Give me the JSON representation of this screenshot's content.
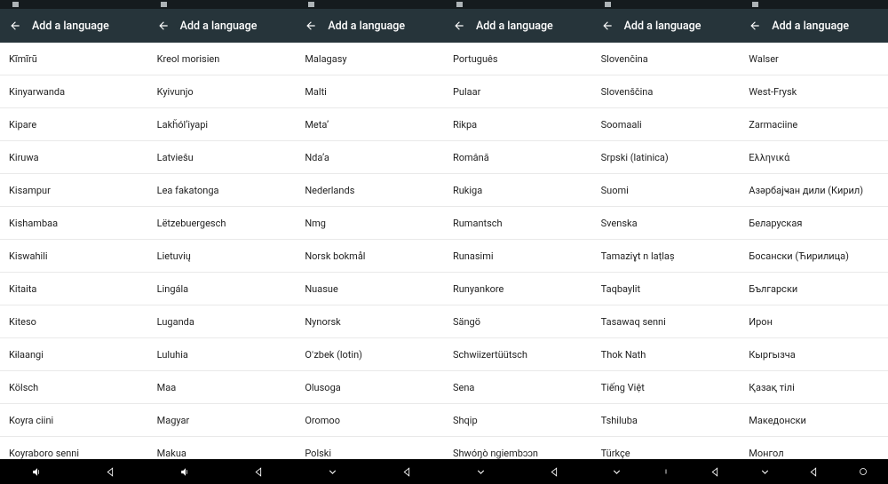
{
  "appbar_title": "Add a language",
  "columns": [
    [
      "Kĩmĩrũ",
      "Kinyarwanda",
      "Kipare",
      "Kiruwa",
      "Kisampur",
      "Kishambaa",
      "Kiswahili",
      "Kitaita",
      "Kiteso",
      "Kɨlaangi",
      "Kölsch",
      "Koyra ciini",
      "Koyraboro senni"
    ],
    [
      "Kreol morisien",
      "Kyivunjo",
      "Lakȟólʼiyapi",
      "Latviešu",
      "Lea fakatonga",
      "Lëtzebuergesch",
      "Lietuvių",
      "Lingála",
      "Luganda",
      "Luluhia",
      "Maa",
      "Magyar",
      "Makua"
    ],
    [
      "Malagasy",
      "Malti",
      "Metaʼ",
      "Ndaʼa",
      "Nederlands",
      "Nmg",
      "Norsk bokmål",
      "Nuasue",
      "Nynorsk",
      "Oʻzbek (lotin)",
      "Olusoga",
      "Oromoo",
      "Polski"
    ],
    [
      "Português",
      "Pulaar",
      "Rikpa",
      "Română",
      "Rukiga",
      "Rumantsch",
      "Runasimi",
      "Runyankore",
      "Sängö",
      "Schwiizertüütsch",
      "Sena",
      "Shqip",
      "Shwóŋò ngiembɔɔn"
    ],
    [
      "Slovenčina",
      "Slovenščina",
      "Soomaali",
      "Srpski (latinica)",
      "Suomi",
      "Svenska",
      "Tamaziɣt n laṭlaṣ",
      "Taqbaylit",
      "Tasawaq senni",
      "Thok Nath",
      "Tiếng Việt",
      "Tshiluba",
      "Türkçe"
    ],
    [
      "Walser",
      "West-Frysk",
      "Zarmaciine",
      "Ελληνικά",
      "Азәрбајҹан дили (Кирил)",
      "Беларуская",
      "Босански (Ћирилица)",
      "Български",
      "Ирон",
      "Кыргызча",
      "Қазақ тілі",
      "Македонски",
      "Монгол"
    ]
  ],
  "nav_left_variant": [
    "volume",
    "volume",
    "chevron-down",
    "chevron-down",
    "chevron-down",
    "chevron-down"
  ]
}
